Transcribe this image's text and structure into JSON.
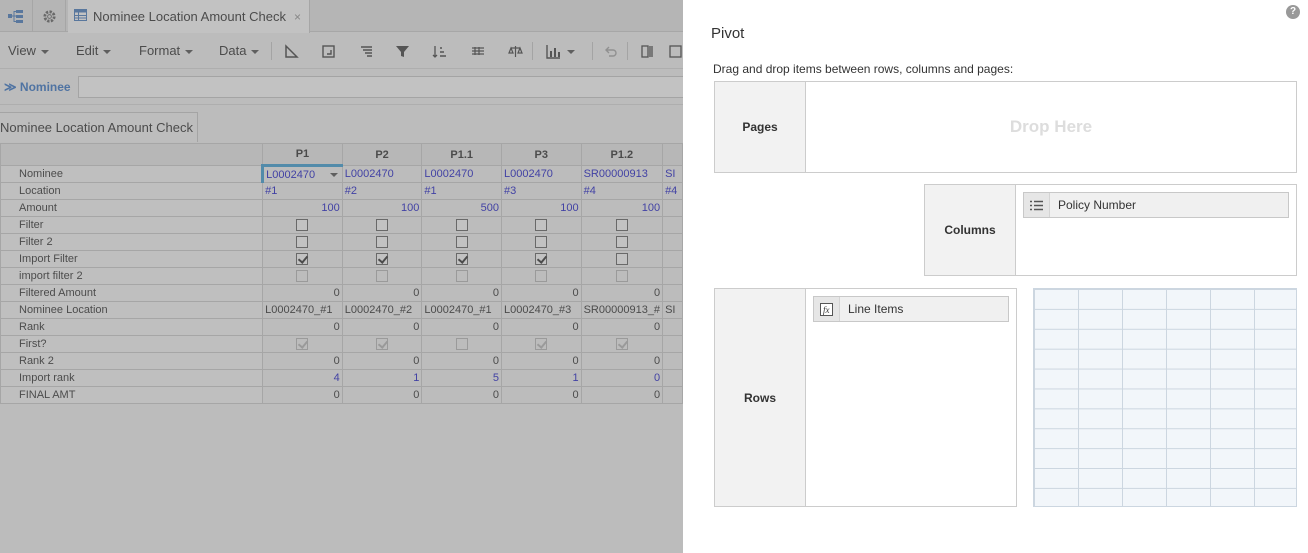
{
  "document_tab": {
    "title": "Nominee Location Amount Check",
    "close": "×"
  },
  "toolbar": {
    "menus": [
      "View",
      "Edit",
      "Format",
      "Data"
    ]
  },
  "filter_bar": {
    "label": "Nominee"
  },
  "module_tab": {
    "title": "Nominee Location Amount Check"
  },
  "grid": {
    "columns": [
      "P1",
      "P2",
      "P1.1",
      "P3",
      "P1.2",
      ""
    ],
    "rows": [
      {
        "label": "Nominee",
        "type": "text",
        "style": "blue",
        "values": [
          "L0002470",
          "L0002470",
          "L0002470",
          "L0002470",
          "SR00000913",
          "SI"
        ]
      },
      {
        "label": "Location",
        "type": "text",
        "style": "blue",
        "values": [
          "#1",
          "#2",
          "#1",
          "#3",
          "#4",
          "#4"
        ]
      },
      {
        "label": "Amount",
        "type": "num",
        "style": "blue",
        "values": [
          "100",
          "100",
          "500",
          "100",
          "100",
          ""
        ]
      },
      {
        "label": "Filter",
        "type": "check",
        "states": [
          "off",
          "off",
          "off",
          "off",
          "off"
        ]
      },
      {
        "label": "Filter 2",
        "type": "check",
        "states": [
          "off",
          "off",
          "off",
          "off",
          "off"
        ]
      },
      {
        "label": "Import Filter",
        "type": "check",
        "states": [
          "on",
          "on",
          "on",
          "on",
          "off"
        ]
      },
      {
        "label": "import filter 2",
        "type": "check",
        "states": [
          "dis",
          "dis",
          "dis",
          "dis",
          "dis"
        ]
      },
      {
        "label": "Filtered Amount",
        "type": "num",
        "style": "",
        "values": [
          "0",
          "0",
          "0",
          "0",
          "0",
          ""
        ]
      },
      {
        "label": "Nominee Location",
        "type": "text",
        "style": "",
        "values": [
          "L0002470_#1",
          "L0002470_#2",
          "L0002470_#1",
          "L0002470_#3",
          "SR00000913_#",
          "SI"
        ]
      },
      {
        "label": "Rank",
        "type": "num",
        "style": "",
        "values": [
          "0",
          "0",
          "0",
          "0",
          "0",
          ""
        ]
      },
      {
        "label": "First?",
        "type": "check",
        "states": [
          "dison",
          "dison",
          "dis",
          "dison",
          "dison"
        ]
      },
      {
        "label": "Rank 2",
        "type": "num",
        "style": "",
        "values": [
          "0",
          "0",
          "0",
          "0",
          "0",
          ""
        ]
      },
      {
        "label": "Import rank",
        "type": "num",
        "style": "blue",
        "values": [
          "4",
          "1",
          "5",
          "1",
          "0",
          ""
        ]
      },
      {
        "label": "FINAL AMT",
        "type": "num",
        "style": "",
        "values": [
          "0",
          "0",
          "0",
          "0",
          "0",
          ""
        ]
      }
    ]
  },
  "pivot": {
    "title": "Pivot",
    "instructions": "Drag and drop items between rows, columns and pages:",
    "pages": {
      "label": "Pages",
      "placeholder": "Drop Here"
    },
    "columns": {
      "label": "Columns",
      "items": [
        {
          "label": "Policy Number",
          "icon": "list-icon"
        }
      ]
    },
    "rows": {
      "label": "Rows",
      "items": [
        {
          "label": "Line Items",
          "icon": "function-icon"
        }
      ]
    },
    "help_icon": "?"
  }
}
